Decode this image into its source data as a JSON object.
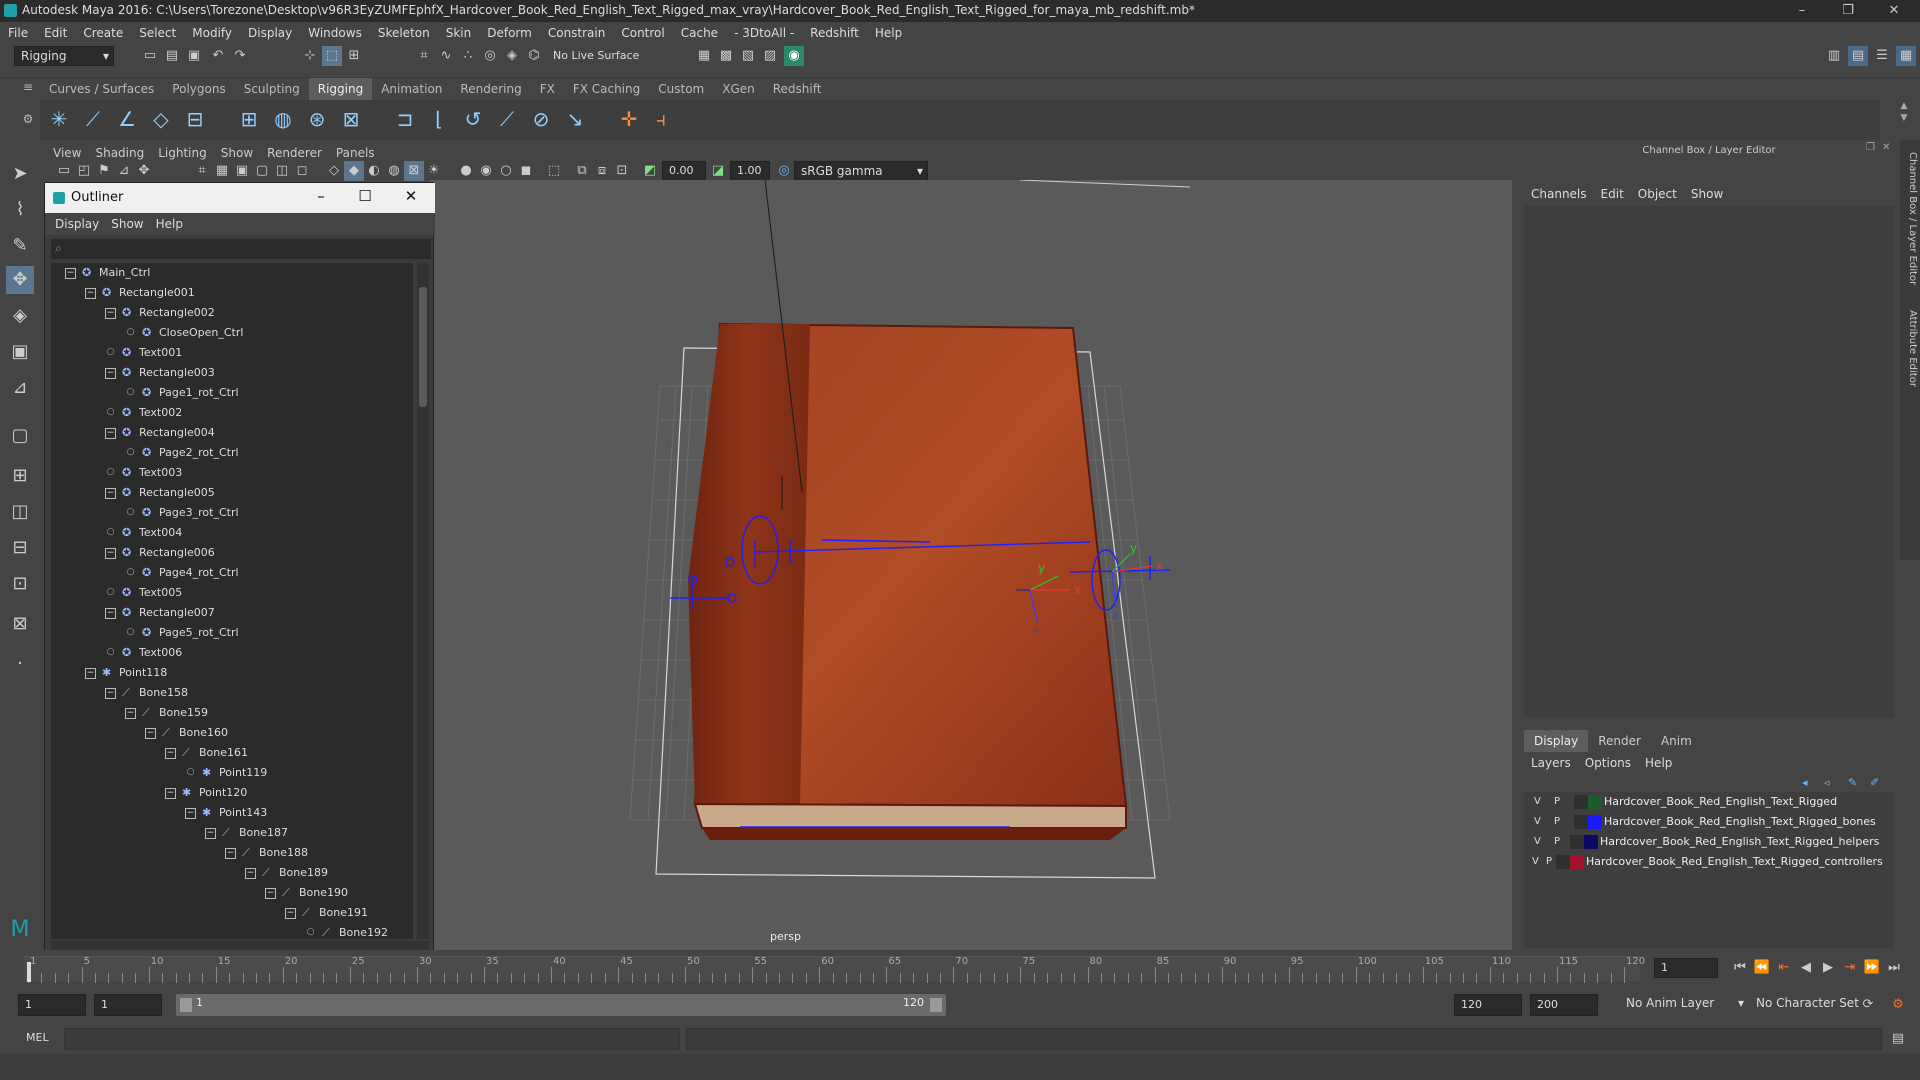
{
  "window": {
    "title": "Autodesk Maya 2016: C:\\Users\\Torezone\\Desktop\\v96R3EyZUMFEphfX_Hardcover_Book_Red_English_Text_Rigged_max_vray\\Hardcover_Book_Red_English_Text_Rigged_for_maya_mb_redshift.mb*",
    "minimize": "–",
    "restore": "❐",
    "close": "✕"
  },
  "menubar": [
    "File",
    "Edit",
    "Create",
    "Select",
    "Modify",
    "Display",
    "Windows",
    "Skeleton",
    "Skin",
    "Deform",
    "Constrain",
    "Control",
    "Cache",
    "- 3DtoAll -",
    "Redshift",
    "Help"
  ],
  "statusline": {
    "mode": "Rigging",
    "live_surface": "No Live Surface"
  },
  "shelf": {
    "tabs": [
      "Curves / Surfaces",
      "Polygons",
      "Sculpting",
      "Rigging",
      "Animation",
      "Rendering",
      "FX",
      "FX Caching",
      "Custom",
      "XGen",
      "Redshift"
    ],
    "active": "Rigging"
  },
  "panel": {
    "menu": [
      "View",
      "Shading",
      "Lighting",
      "Show",
      "Renderer",
      "Panels"
    ],
    "exposure": "0.00",
    "gamma": "1.00",
    "colorspace": "sRGB gamma",
    "camera_label": "persp"
  },
  "outliner": {
    "title": "Outliner",
    "menu": [
      "Display",
      "Show",
      "Help"
    ],
    "nodes": [
      {
        "name": "Main_Ctrl",
        "depth": 0,
        "exp": "−",
        "icon": "curve"
      },
      {
        "name": "Rectangle001",
        "depth": 1,
        "exp": "−",
        "icon": "curve"
      },
      {
        "name": "Rectangle002",
        "depth": 2,
        "exp": "−",
        "icon": "curve"
      },
      {
        "name": "CloseOpen_Ctrl",
        "depth": 3,
        "exp": "",
        "icon": "curve"
      },
      {
        "name": "Text001",
        "depth": 2,
        "exp": "",
        "icon": "curve"
      },
      {
        "name": "Rectangle003",
        "depth": 2,
        "exp": "−",
        "icon": "curve"
      },
      {
        "name": "Page1_rot_Ctrl",
        "depth": 3,
        "exp": "",
        "icon": "curve"
      },
      {
        "name": "Text002",
        "depth": 2,
        "exp": "",
        "icon": "curve"
      },
      {
        "name": "Rectangle004",
        "depth": 2,
        "exp": "−",
        "icon": "curve"
      },
      {
        "name": "Page2_rot_Ctrl",
        "depth": 3,
        "exp": "",
        "icon": "curve"
      },
      {
        "name": "Text003",
        "depth": 2,
        "exp": "",
        "icon": "curve"
      },
      {
        "name": "Rectangle005",
        "depth": 2,
        "exp": "−",
        "icon": "curve"
      },
      {
        "name": "Page3_rot_Ctrl",
        "depth": 3,
        "exp": "",
        "icon": "curve"
      },
      {
        "name": "Text004",
        "depth": 2,
        "exp": "",
        "icon": "curve"
      },
      {
        "name": "Rectangle006",
        "depth": 2,
        "exp": "−",
        "icon": "curve"
      },
      {
        "name": "Page4_rot_Ctrl",
        "depth": 3,
        "exp": "",
        "icon": "curve"
      },
      {
        "name": "Text005",
        "depth": 2,
        "exp": "",
        "icon": "curve"
      },
      {
        "name": "Rectangle007",
        "depth": 2,
        "exp": "−",
        "icon": "curve"
      },
      {
        "name": "Page5_rot_Ctrl",
        "depth": 3,
        "exp": "",
        "icon": "curve"
      },
      {
        "name": "Text006",
        "depth": 2,
        "exp": "",
        "icon": "curve"
      },
      {
        "name": "Point118",
        "depth": 1,
        "exp": "−",
        "icon": "point"
      },
      {
        "name": "Bone158",
        "depth": 2,
        "exp": "−",
        "icon": "bone"
      },
      {
        "name": "Bone159",
        "depth": 3,
        "exp": "−",
        "icon": "bone"
      },
      {
        "name": "Bone160",
        "depth": 4,
        "exp": "−",
        "icon": "bone"
      },
      {
        "name": "Bone161",
        "depth": 5,
        "exp": "−",
        "icon": "bone"
      },
      {
        "name": "Point119",
        "depth": 6,
        "exp": "",
        "icon": "point"
      },
      {
        "name": "Point120",
        "depth": 5,
        "exp": "−",
        "icon": "point"
      },
      {
        "name": "Point143",
        "depth": 6,
        "exp": "−",
        "icon": "point"
      },
      {
        "name": "Bone187",
        "depth": 7,
        "exp": "−",
        "icon": "bone"
      },
      {
        "name": "Bone188",
        "depth": 8,
        "exp": "−",
        "icon": "bone"
      },
      {
        "name": "Bone189",
        "depth": 9,
        "exp": "−",
        "icon": "bone"
      },
      {
        "name": "Bone190",
        "depth": 10,
        "exp": "−",
        "icon": "bone"
      },
      {
        "name": "Bone191",
        "depth": 11,
        "exp": "−",
        "icon": "bone"
      },
      {
        "name": "Bone192",
        "depth": 12,
        "exp": "",
        "icon": "bone"
      }
    ]
  },
  "channelbox": {
    "header": "Channel Box / Layer Editor",
    "menu": [
      "Channels",
      "Edit",
      "Object",
      "Show"
    ]
  },
  "layereditor": {
    "tabs": [
      "Display",
      "Render",
      "Anim"
    ],
    "active": "Display",
    "menu": [
      "Layers",
      "Options",
      "Help"
    ],
    "layers": [
      {
        "v": "V",
        "p": "P",
        "color": "#1a5c2a",
        "name": "Hardcover_Book_Red_English_Text_Rigged"
      },
      {
        "v": "V",
        "p": "P",
        "color": "#1a1aff",
        "name": "Hardcover_Book_Red_English_Text_Rigged_bones"
      },
      {
        "v": "V",
        "p": "P",
        "color": "#0a0a66",
        "name": "Hardcover_Book_Red_English_Text_Rigged_helpers"
      },
      {
        "v": "V",
        "p": "P",
        "color": "#a3122a",
        "name": "Hardcover_Book_Red_English_Text_Rigged_controllers"
      }
    ]
  },
  "sidetabs": [
    "Channel Box / Layer Editor",
    "Attribute Editor"
  ],
  "timeline": {
    "ticks": [
      "1",
      "5",
      "10",
      "15",
      "20",
      "25",
      "30",
      "35",
      "40",
      "45",
      "50",
      "55",
      "60",
      "65",
      "70",
      "75",
      "80",
      "85",
      "90",
      "95",
      "100",
      "105",
      "110",
      "115",
      "120"
    ],
    "current_frame": "1"
  },
  "range": {
    "start": "1",
    "inner_start": "1",
    "slider_start": "1",
    "slider_end": "120",
    "end": "120",
    "anim_end": "200",
    "anim_layer": "No Anim Layer",
    "char_set": "No Character Set"
  },
  "cmd": {
    "label": "MEL"
  },
  "axes": {
    "x": "x",
    "y": "y",
    "z": "z"
  }
}
